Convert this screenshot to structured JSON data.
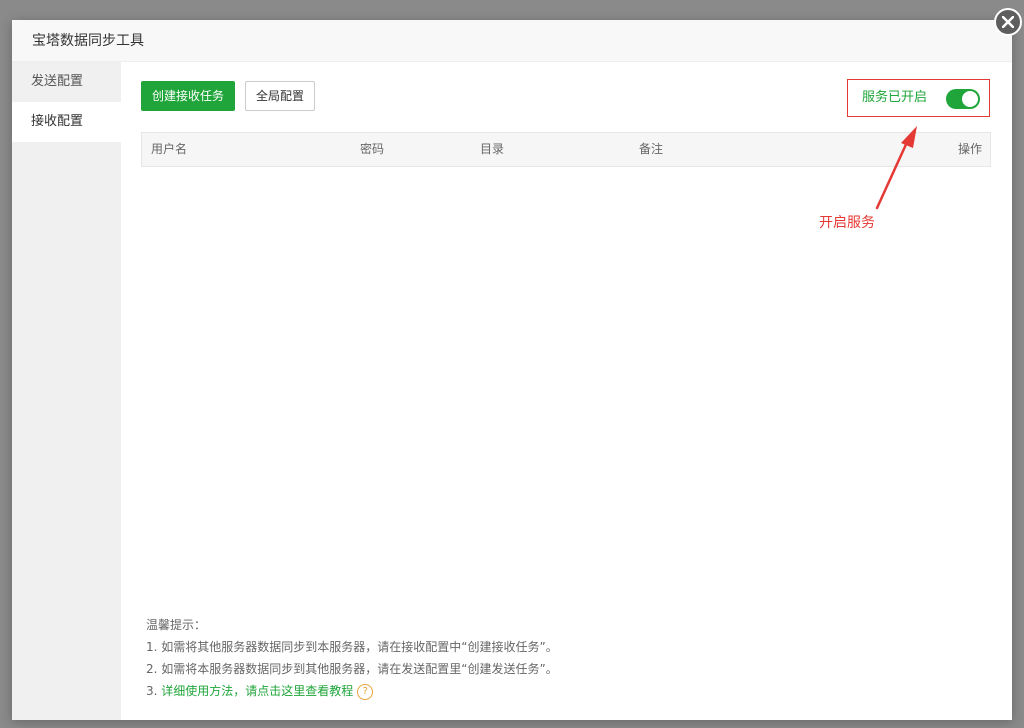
{
  "window": {
    "title": "宝塔数据同步工具"
  },
  "sidebar": {
    "items": [
      {
        "label": "发送配置",
        "active": false
      },
      {
        "label": "接收配置",
        "active": true
      }
    ]
  },
  "toolbar": {
    "create_label": "创建接收任务",
    "global_label": "全局配置"
  },
  "service": {
    "status_label": "服务已开启",
    "enabled": true
  },
  "table": {
    "columns": [
      "用户名",
      "密码",
      "目录",
      "备注",
      "操作"
    ],
    "rows": []
  },
  "annotation": {
    "text": "开启服务",
    "color": "#e53935"
  },
  "tips": {
    "title": "温馨提示：",
    "lines": [
      "1. 如需将其他服务器数据同步到本服务器，请在接收配置中“创建接收任务”。",
      "2. 如需将本服务器数据同步到其他服务器，请在发送配置里“创建发送任务”。"
    ],
    "link_prefix": "3. ",
    "link_text": "详细使用方法，请点击这里查看教程",
    "help_glyph": "?"
  },
  "colors": {
    "accent": "#20a53a",
    "annotation": "#e53935",
    "help": "#e6a23c"
  },
  "icons": {
    "close": "close-icon",
    "help": "question-circle-icon"
  }
}
